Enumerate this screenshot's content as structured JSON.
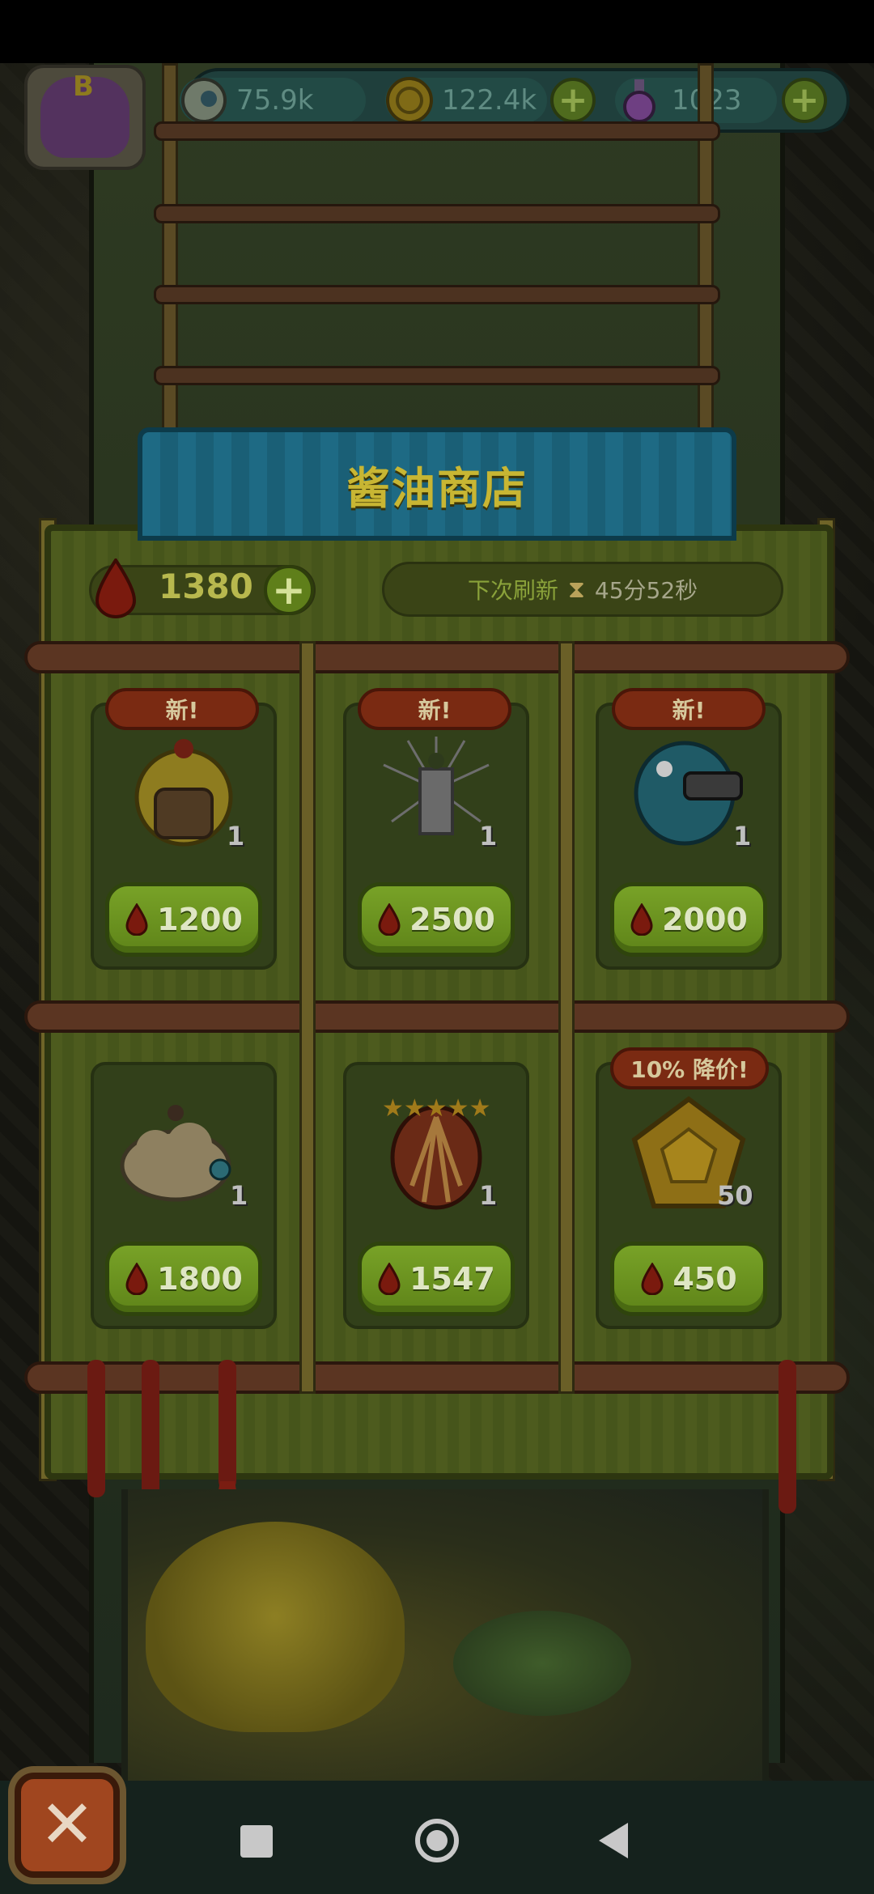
{
  "resources": {
    "eyes": "75.9k",
    "coins": "122.4k",
    "potion": "1023"
  },
  "avatar": {
    "letter": "B"
  },
  "shop": {
    "title": "酱油商店",
    "currency_value": "1380",
    "refresh_label": "下次刷新",
    "refresh_time": "45分52秒",
    "items": [
      {
        "badge": "新!",
        "qty": "1",
        "price": "1200",
        "art": "yellow-chick-monster-icon"
      },
      {
        "badge": "新!",
        "qty": "1",
        "price": "2500",
        "art": "spiky-gray-monster-icon"
      },
      {
        "badge": "新!",
        "qty": "1",
        "price": "2000",
        "art": "blue-fish-monster-icon"
      },
      {
        "badge": "",
        "qty": "1",
        "price": "1800",
        "art": "cloud-monster-icon"
      },
      {
        "badge": "",
        "qty": "1",
        "price": "1547",
        "art": "five-star-egg-icon"
      },
      {
        "badge": "10% 降价!",
        "qty": "50",
        "price": "450",
        "art": "gold-gem-icon"
      }
    ]
  },
  "colors": {
    "panel": "#4d5b1e",
    "banner": "#1e6a84",
    "price_button": "#78a227",
    "badge": "#7a2a12",
    "drop": "#8a1d10"
  }
}
